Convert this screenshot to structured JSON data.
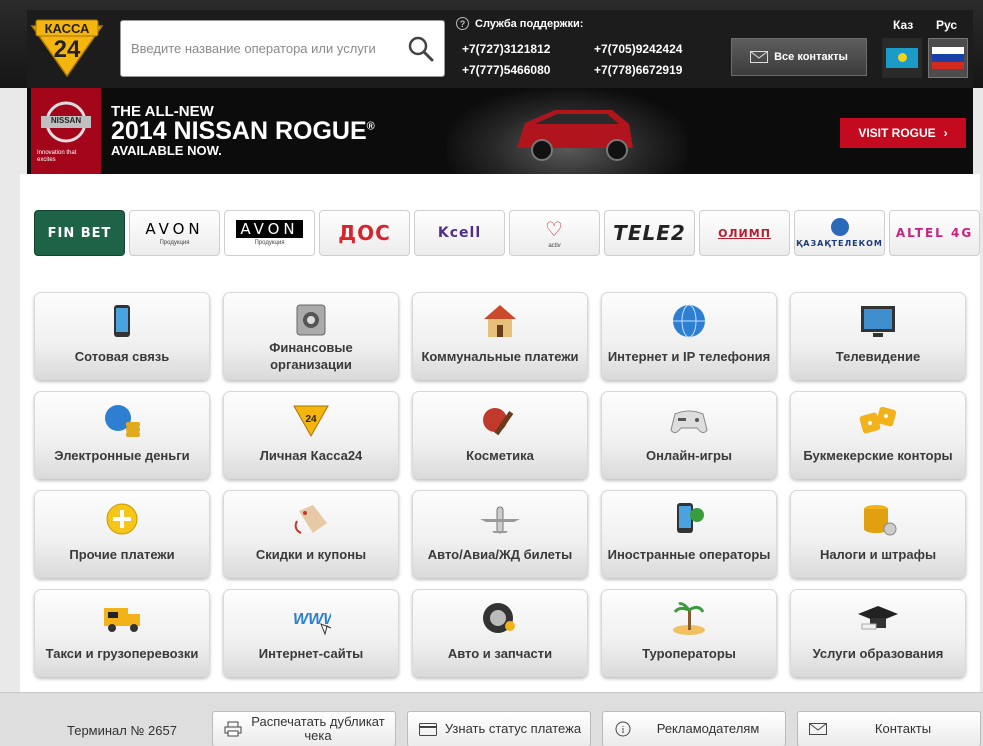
{
  "header": {
    "logo_text_top": "КАССА",
    "logo_text_num": "24",
    "search_placeholder": "Введите название оператора или услуги",
    "support_title": "Служба поддержки:",
    "phones": [
      "+7(727)3121812",
      "+7(705)9242424",
      "+7(777)5466080",
      "+7(778)6672919"
    ],
    "contacts_label": "Все контакты",
    "lang_kz": "Каз",
    "lang_ru": "Рус"
  },
  "banner": {
    "brand_label": "NISSAN",
    "tagline": "Innovation that excites",
    "line1": "THE ALL-NEW",
    "line2": "2014 NISSAN ROGUE",
    "line2_mark": "®",
    "line3": "AVAILABLE NOW.",
    "cta": "VISIT ROGUE"
  },
  "brands": [
    {
      "name": "FIN BET",
      "sub": ""
    },
    {
      "name": "AVON",
      "sub": "Продукция"
    },
    {
      "name": "AVON",
      "sub": "Продукция"
    },
    {
      "name": "ДОС",
      "sub": ""
    },
    {
      "name": "Kcell",
      "sub": ""
    },
    {
      "name": "activ",
      "sub": "activ"
    },
    {
      "name": "TELE2",
      "sub": ""
    },
    {
      "name": "ОЛИМП",
      "sub": ""
    },
    {
      "name": "ҚАЗАҚТЕЛЕКОМ",
      "sub": ""
    },
    {
      "name": "ALTEL 4G",
      "sub": ""
    }
  ],
  "categories": [
    {
      "label": "Сотовая связь",
      "icon": "mobile-phone-icon"
    },
    {
      "label": "Финансовые организации",
      "icon": "safe-icon"
    },
    {
      "label": "Коммунальные платежи",
      "icon": "house-icon"
    },
    {
      "label": "Интернет и IP телефония",
      "icon": "globe-icon"
    },
    {
      "label": "Телевидение",
      "icon": "tv-icon"
    },
    {
      "label": "Электронные деньги",
      "icon": "globe-coins-icon"
    },
    {
      "label": "Личная Касса24",
      "icon": "kassa24-badge-icon"
    },
    {
      "label": "Косметика",
      "icon": "cosmetics-icon"
    },
    {
      "label": "Онлайн-игры",
      "icon": "gamepad-icon"
    },
    {
      "label": "Букмекерские конторы",
      "icon": "dice-icon"
    },
    {
      "label": "Прочие платежи",
      "icon": "plus-circle-icon"
    },
    {
      "label": "Скидки и купоны",
      "icon": "price-tag-icon"
    },
    {
      "label": "Авто/Авиа/ЖД билеты",
      "icon": "airplane-icon"
    },
    {
      "label": "Иностранные операторы",
      "icon": "phone-globe-icon"
    },
    {
      "label": "Налоги и штрафы",
      "icon": "coins-icon"
    },
    {
      "label": "Такси и грузоперевозки",
      "icon": "taxi-truck-icon"
    },
    {
      "label": "Интернет-сайты",
      "icon": "www-icon"
    },
    {
      "label": "Авто и запчасти",
      "icon": "tire-icon"
    },
    {
      "label": "Туроператоры",
      "icon": "palm-island-icon"
    },
    {
      "label": "Услуги образования",
      "icon": "graduation-cap-icon"
    }
  ],
  "footer": {
    "terminal": "Терминал № 2657",
    "print_duplicate": "Распечатать дубликат чека",
    "payment_status": "Узнать статус платежа",
    "advertisers": "Рекламодателям",
    "contacts": "Контакты"
  },
  "colors": {
    "header_bg": "#1c1c1c",
    "logo_yellow": "#f5b50f",
    "visit_red": "#c40a1f",
    "finbet_green": "#1e6247"
  }
}
